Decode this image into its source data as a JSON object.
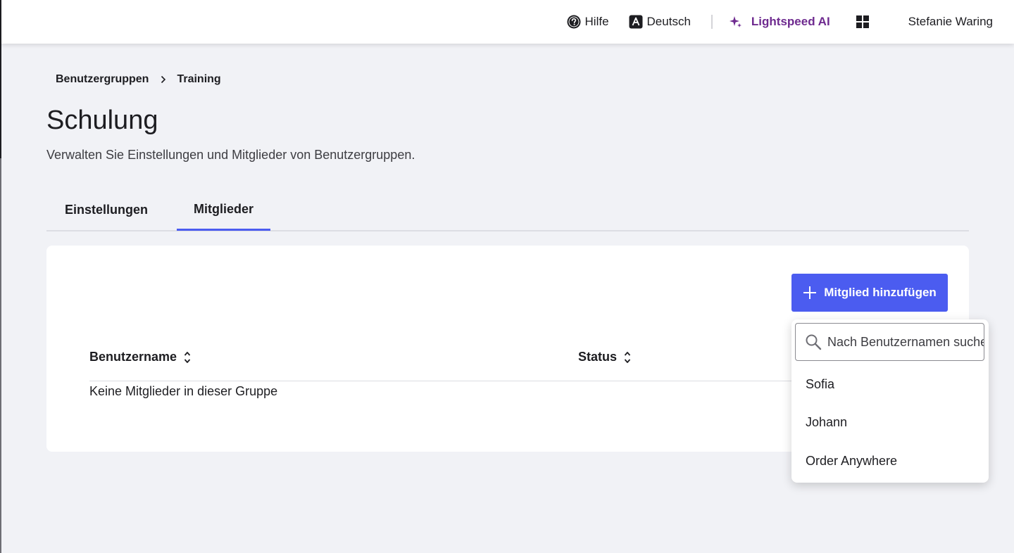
{
  "topbar": {
    "help_label": "Hilfe",
    "language_label": "Deutsch",
    "ai_label": "Lightspeed AI",
    "user_name": "Stefanie Waring"
  },
  "breadcrumb": {
    "items": [
      "Benutzergruppen",
      "Training"
    ]
  },
  "header": {
    "title": "Schulung",
    "subtitle": "Verwalten Sie Einstellungen und Mitglieder von Benutzergruppen."
  },
  "tabs": [
    {
      "label": "Einstellungen",
      "active": false
    },
    {
      "label": "Mitglieder",
      "active": true
    }
  ],
  "members": {
    "add_button_label": "Mitglied hinzufügen",
    "columns": [
      "Benutzername",
      "Status"
    ],
    "empty_text": "Keine Mitglieder in dieser Gruppe"
  },
  "dropdown": {
    "search_placeholder": "Nach Benutzernamen suchen",
    "options": [
      "Sofia",
      "Johann",
      "Order Anywhere"
    ]
  },
  "colors": {
    "accent": "#4b5cf0",
    "ai": "#6e2a8f",
    "background": "#f1f2f6"
  },
  "icons": {
    "help": "question-circle-icon",
    "language": "letter-a-icon",
    "ai": "sparkle-icon",
    "apps": "grid-icon",
    "breadcrumb_separator": "chevron-right-icon",
    "sort": "sort-updown-icon",
    "add": "plus-icon",
    "search": "search-icon"
  }
}
